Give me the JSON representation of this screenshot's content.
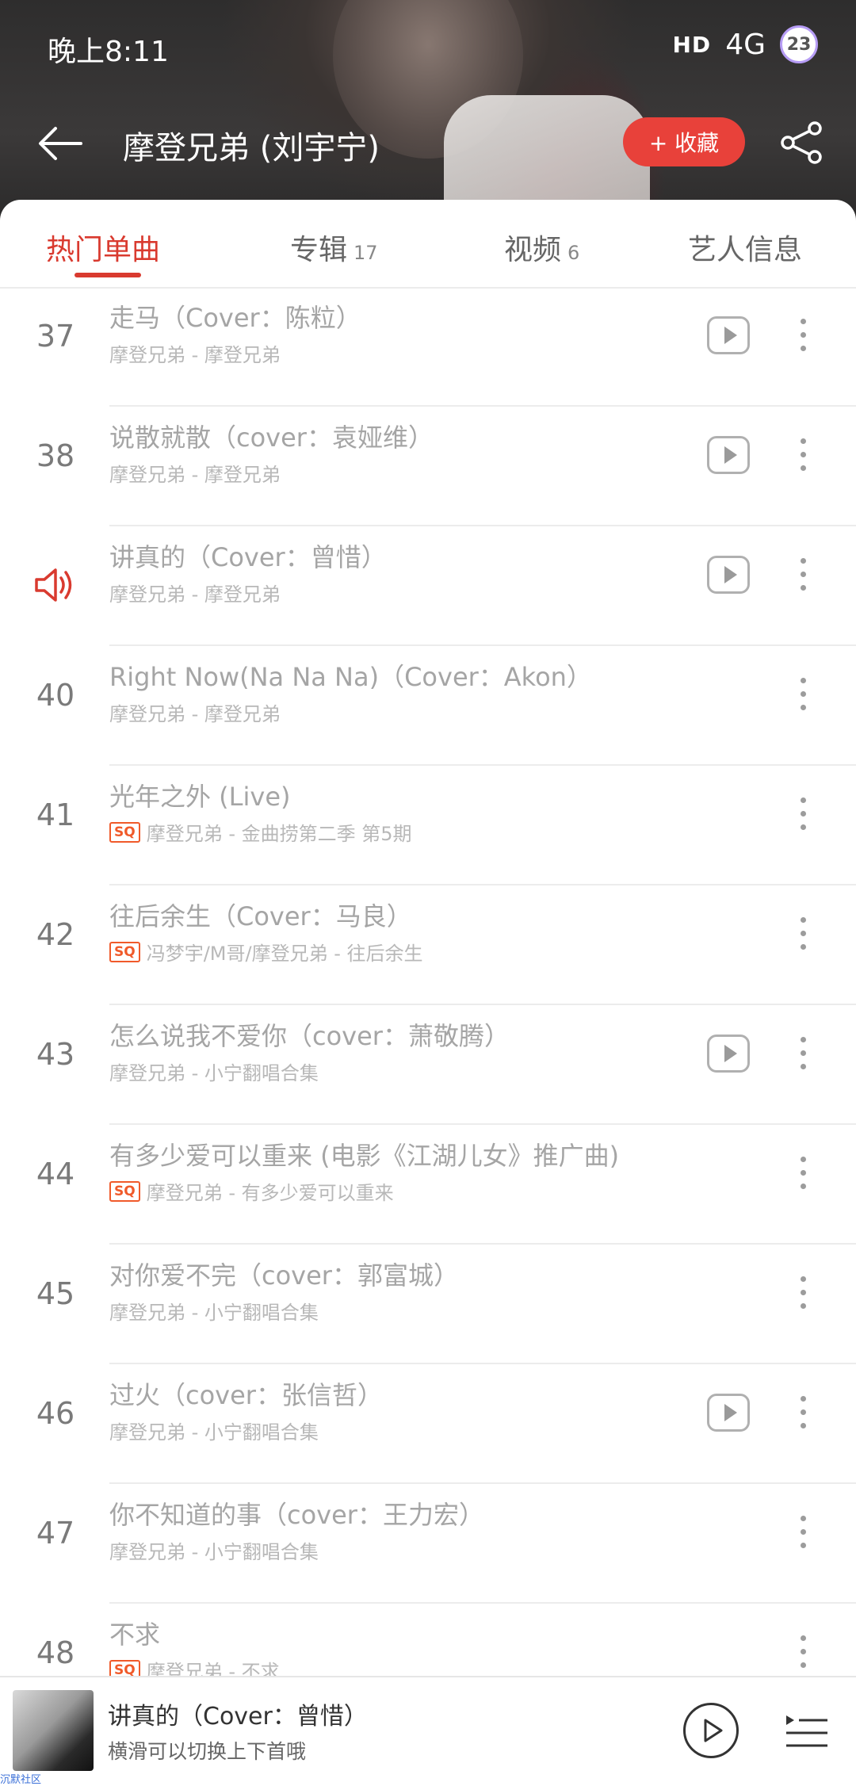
{
  "status_bar": {
    "time": "晚上8:11",
    "signal": "HD",
    "network": "4G",
    "notifications": "23"
  },
  "header": {
    "title": "摩登兄弟 (刘宇宁)",
    "favorite_label": "+ 收藏"
  },
  "tabs": [
    {
      "label": "热门单曲",
      "count": ""
    },
    {
      "label": "专辑",
      "count": "17"
    },
    {
      "label": "视频",
      "count": "6"
    },
    {
      "label": "艺人信息",
      "count": ""
    }
  ],
  "songs": [
    {
      "index": "37",
      "title": "走马（Cover：陈粒）",
      "subtitle": "摩登兄弟 - 摩登兄弟",
      "sq": false,
      "mv": true,
      "playing": false
    },
    {
      "index": "38",
      "title": "说散就散（cover：袁娅维）",
      "subtitle": "摩登兄弟 - 摩登兄弟",
      "sq": false,
      "mv": true,
      "playing": false
    },
    {
      "index": "",
      "title": "讲真的（Cover：曾惜）",
      "subtitle": "摩登兄弟 - 摩登兄弟",
      "sq": false,
      "mv": true,
      "playing": true
    },
    {
      "index": "40",
      "title": "Right Now(Na Na Na)（Cover：Akon）",
      "subtitle": "摩登兄弟 - 摩登兄弟",
      "sq": false,
      "mv": false,
      "playing": false
    },
    {
      "index": "41",
      "title": "光年之外 (Live)",
      "subtitle": "摩登兄弟 - 金曲捞第二季 第5期",
      "sq": true,
      "mv": false,
      "playing": false
    },
    {
      "index": "42",
      "title": "往后余生（Cover：马良）",
      "subtitle": "冯梦宇/M哥/摩登兄弟 - 往后余生",
      "sq": true,
      "mv": false,
      "playing": false
    },
    {
      "index": "43",
      "title": "怎么说我不爱你（cover：萧敬腾）",
      "subtitle": "摩登兄弟 - 小宁翻唱合集",
      "sq": false,
      "mv": true,
      "playing": false
    },
    {
      "index": "44",
      "title": "有多少爱可以重来 (电影《江湖儿女》推广曲)",
      "subtitle": "摩登兄弟 - 有多少爱可以重来",
      "sq": true,
      "mv": false,
      "playing": false
    },
    {
      "index": "45",
      "title": "对你爱不完（cover：郭富城）",
      "subtitle": "摩登兄弟 - 小宁翻唱合集",
      "sq": false,
      "mv": false,
      "playing": false
    },
    {
      "index": "46",
      "title": "过火（cover：张信哲）",
      "subtitle": "摩登兄弟 - 小宁翻唱合集",
      "sq": false,
      "mv": true,
      "playing": false
    },
    {
      "index": "47",
      "title": "你不知道的事（cover：王力宏）",
      "subtitle": "摩登兄弟 - 小宁翻唱合集",
      "sq": false,
      "mv": false,
      "playing": false
    },
    {
      "index": "48",
      "title": "不求",
      "subtitle": "摩登兄弟 - 不求",
      "sq": true,
      "mv": false,
      "playing": false
    }
  ],
  "sq_label": "SQ",
  "player": {
    "title": "讲真的（Cover：曾惜）",
    "hint": "横滑可以切换上下首哦"
  },
  "footer_watermark": "沉默社区",
  "colors": {
    "accent": "#d93a2f",
    "favorite_button": "#e8413a",
    "sq_badge": "#f05a2a"
  }
}
